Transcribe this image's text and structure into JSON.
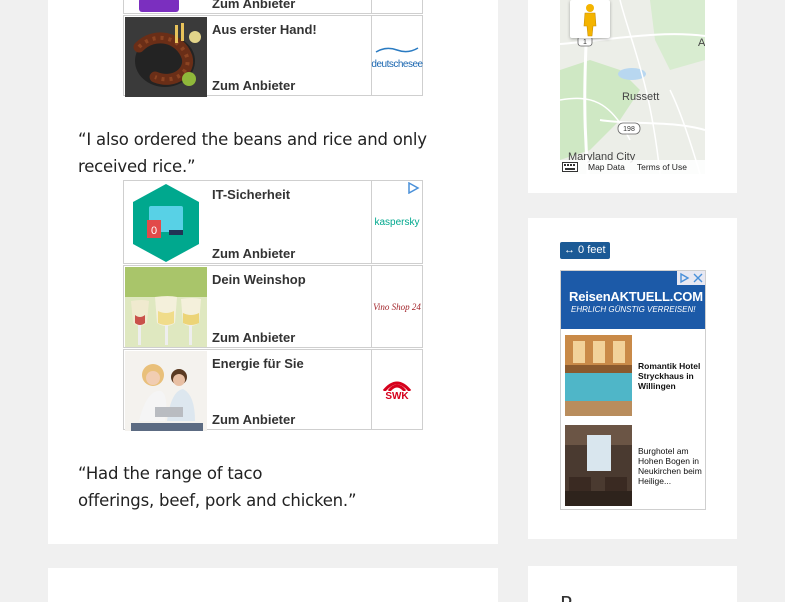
{
  "ads": [
    {
      "title": "",
      "cta": "Zum Anbieter",
      "logo": ""
    },
    {
      "title": "Aus erster Hand!",
      "cta": "Zum Anbieter",
      "logo": "deutschesee"
    },
    {
      "title": "IT-Sicherheit",
      "cta": "Zum Anbieter",
      "logo": "kaspersky"
    },
    {
      "title": "Dein Weinshop",
      "cta": "Zum Anbieter",
      "logo": "Vino Shop 24"
    },
    {
      "title": "Energie für Sie",
      "cta": "Zum Anbieter",
      "logo": "SWK"
    }
  ],
  "quotes": [
    {
      "line1": "“I also ordered the beans and rice and only",
      "line2": "received rice.”"
    },
    {
      "line1": "“Had the range of taco",
      "line2": "offerings, beef, pork and chicken.”"
    }
  ],
  "map": {
    "places": [
      "Russett",
      "Maryland City"
    ],
    "routes": [
      "1",
      "198"
    ],
    "footer_data": "Map Data",
    "footer_terms": "Terms of Use",
    "edge_letter": "A"
  },
  "scale": "↔ 0 feet",
  "reisen": {
    "brand": "ReisenAKTUELL.COM",
    "tagline": "EHRLICH GÜNSTIG VERREISEN!",
    "items": [
      {
        "text": "Romantik Hotel Stryckhaus in Willingen"
      },
      {
        "text": "Burghotel am Hohen Bogen in Neukirchen beim Heilige..."
      }
    ]
  },
  "sidebar_heading": "R",
  "colors": {
    "accent": "#1b5a96",
    "reisen_blue": "#1c5aa8",
    "kaspersky": "#00a88e",
    "swk": "#d6001c"
  }
}
